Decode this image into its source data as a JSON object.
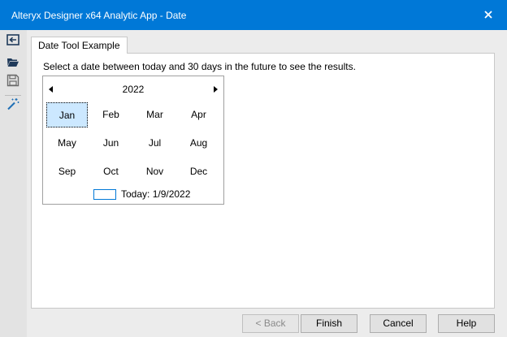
{
  "window": {
    "title": "Alteryx Designer x64 Analytic App - Date",
    "close_icon": "close-icon"
  },
  "toolbar": {
    "items": [
      {
        "name": "exit-icon"
      },
      {
        "name": "open-folder-icon"
      },
      {
        "name": "save-icon"
      },
      {
        "name": "magic-wand-icon"
      }
    ]
  },
  "tab": {
    "label": "Date Tool Example"
  },
  "panel": {
    "instructions": "Select a date between today and 30 days in the future to see the results."
  },
  "calendar": {
    "year": "2022",
    "months": [
      "Jan",
      "Feb",
      "Mar",
      "Apr",
      "May",
      "Jun",
      "Jul",
      "Aug",
      "Sep",
      "Oct",
      "Nov",
      "Dec"
    ],
    "selected_month": "Jan",
    "today_label": "Today: 1/9/2022",
    "accent_color": "#cce8ff"
  },
  "buttons": {
    "back": "< Back",
    "finish": "Finish",
    "cancel": "Cancel",
    "help": "Help"
  },
  "colors": {
    "titlebar": "#0078d7",
    "selection": "#cce8ff"
  }
}
